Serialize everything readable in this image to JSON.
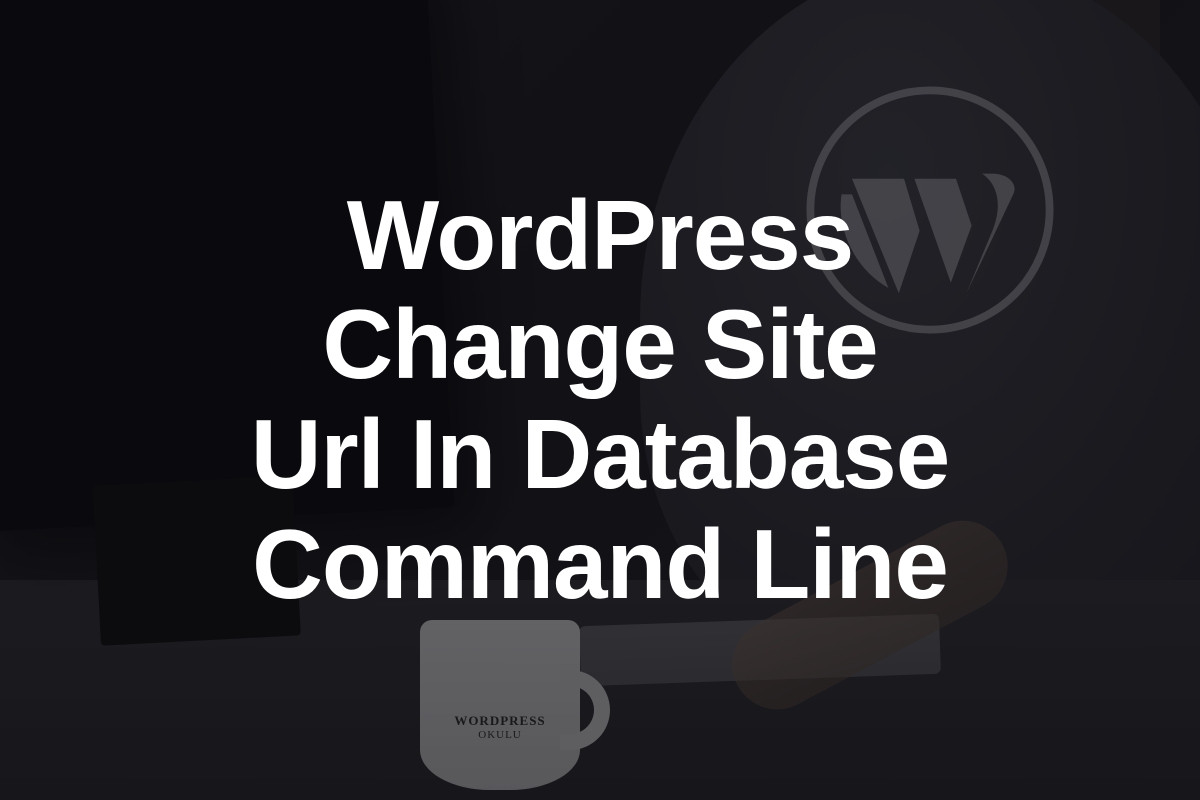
{
  "hero": {
    "title_line1": "WordPress",
    "title_line2": "Change Site",
    "title_line3": "Url In Database",
    "title_line4": "Command Line"
  },
  "mug": {
    "line1": "WORDPRESS",
    "line2": "OKULU"
  },
  "logo": {
    "name": "wordpress"
  },
  "colors": {
    "text": "#ffffff",
    "overlay": "rgba(10,10,14,0.62)",
    "mug": "#f2f2f2"
  }
}
